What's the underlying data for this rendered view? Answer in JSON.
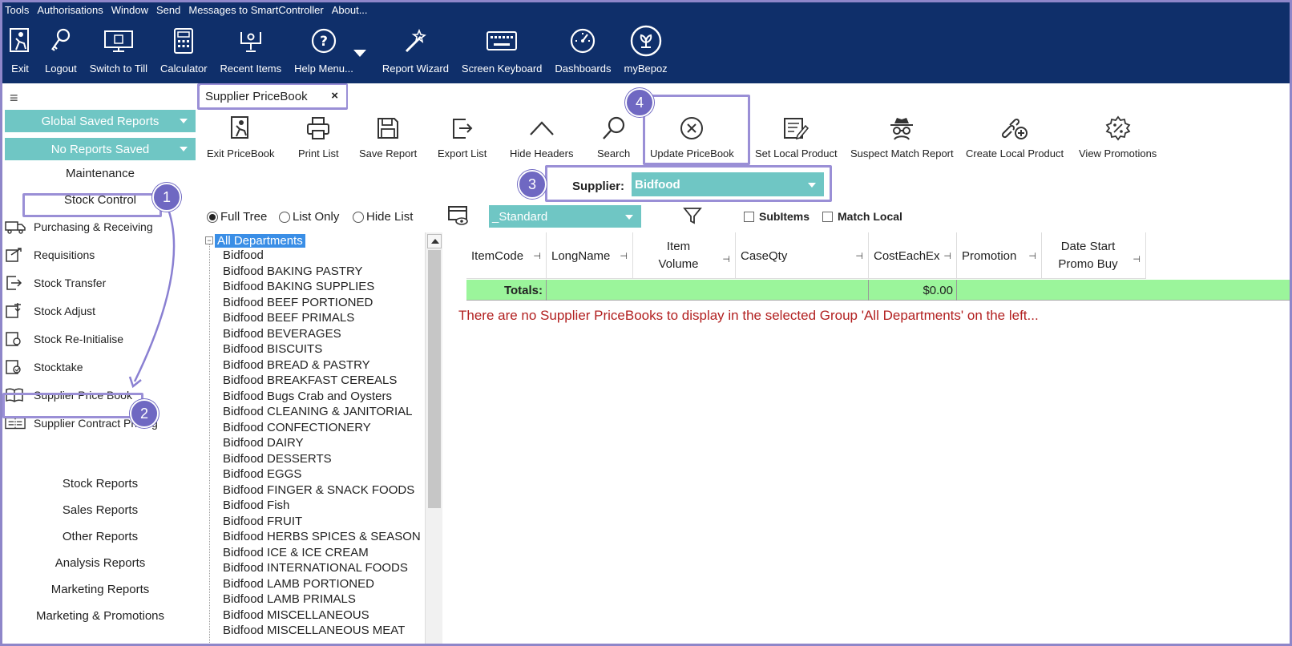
{
  "menubar": [
    "Tools",
    "Authorisations",
    "Window",
    "Send",
    "Messages to SmartController",
    "About..."
  ],
  "toolbar_main": [
    {
      "label": "Exit",
      "icon": "exit-icon"
    },
    {
      "label": "Logout",
      "icon": "key-icon"
    },
    {
      "label": "Switch to Till",
      "icon": "till-icon"
    },
    {
      "label": "Calculator",
      "icon": "calculator-icon"
    },
    {
      "label": "Recent Items",
      "icon": "recent-items-icon"
    },
    {
      "label": "Help Menu...",
      "icon": "help-icon"
    },
    {
      "label": "Report Wizard",
      "icon": "wand-icon"
    },
    {
      "label": "Screen Keyboard",
      "icon": "keyboard-icon"
    },
    {
      "label": "Dashboards",
      "icon": "gauge-icon"
    },
    {
      "label": "myBepoz",
      "icon": "bepoz-logo-icon"
    }
  ],
  "sidebar": {
    "global_reports": "Global Saved Reports",
    "no_reports": "No Reports Saved",
    "maintenance": "Maintenance",
    "stock_control": "Stock Control",
    "items": [
      {
        "label": "Purchasing & Receiving",
        "icon": "truck-icon"
      },
      {
        "label": "Requisitions",
        "icon": "requisition-icon"
      },
      {
        "label": "Stock Transfer",
        "icon": "transfer-icon"
      },
      {
        "label": "Stock Adjust",
        "icon": "adjust-icon"
      },
      {
        "label": "Stock Re-Initialise",
        "icon": "reinitialise-icon"
      },
      {
        "label": "Stocktake",
        "icon": "stocktake-icon"
      },
      {
        "label": "Supplier Price Book",
        "icon": "book-icon"
      },
      {
        "label": "Supplier Contract Pricing",
        "icon": "contract-icon"
      }
    ],
    "reports": [
      "Stock Reports",
      "Sales Reports",
      "Other Reports",
      "Analysis Reports",
      "Marketing Reports",
      "Marketing & Promotions"
    ]
  },
  "tab": {
    "label": "Supplier PriceBook",
    "close": "×"
  },
  "pricebook_toolbar": [
    {
      "label": "Exit PriceBook"
    },
    {
      "label": "Print List"
    },
    {
      "label": "Save Report"
    },
    {
      "label": "Export List"
    },
    {
      "label": "Hide Headers"
    },
    {
      "label": "Search"
    },
    {
      "label": "Update PriceBook"
    },
    {
      "label": "Set Local Product"
    },
    {
      "label": "Suspect Match Report"
    },
    {
      "label": "Create Local Product"
    },
    {
      "label": "View Promotions"
    }
  ],
  "supplier": {
    "label": "Supplier:",
    "value": "Bidfood"
  },
  "view_options": {
    "full_tree": "Full Tree",
    "list_only": "List Only",
    "hide_list": "Hide List",
    "selected": "full_tree"
  },
  "layout_dropdown": "_Standard",
  "checkboxes": {
    "subitems": "SubItems",
    "match_local": "Match Local"
  },
  "tree": {
    "root": "All Departments",
    "children": [
      "Bidfood",
      "Bidfood BAKING PASTRY",
      "Bidfood BAKING SUPPLIES",
      "Bidfood BEEF PORTIONED",
      "Bidfood BEEF PRIMALS",
      "Bidfood BEVERAGES",
      "Bidfood BISCUITS",
      "Bidfood BREAD & PASTRY",
      "Bidfood BREAKFAST CEREALS",
      "Bidfood Bugs  Crab and Oysters",
      "Bidfood CLEANING & JANITORIAL",
      "Bidfood CONFECTIONERY",
      "Bidfood DAIRY",
      "Bidfood DESSERTS",
      "Bidfood EGGS",
      "Bidfood FINGER & SNACK FOODS",
      "Bidfood Fish",
      "Bidfood FRUIT",
      "Bidfood HERBS  SPICES & SEASON",
      "Bidfood ICE & ICE CREAM",
      "Bidfood INTERNATIONAL FOODS",
      "Bidfood LAMB PORTIONED",
      "Bidfood LAMB PRIMALS",
      "Bidfood MISCELLANEOUS",
      "Bidfood MISCELLANEOUS MEAT"
    ]
  },
  "grid": {
    "columns": [
      {
        "label": "ItemCode"
      },
      {
        "label": "LongName"
      },
      {
        "label": "Item\nVolume"
      },
      {
        "label": "CaseQty"
      },
      {
        "label": "CostEachEx"
      },
      {
        "label": "Promotion"
      },
      {
        "label": "Date Start\nPromo Buy"
      }
    ],
    "totals_label": "Totals:",
    "totals_cost": "$0.00",
    "empty_message": "There are no Supplier PriceBooks to display in the selected Group 'All Departments' on the left..."
  },
  "badges": [
    "1",
    "2",
    "3",
    "4"
  ],
  "colors": {
    "topbar": "#0f2f6a",
    "teal": "#6fc6c4",
    "totals": "#9bf59b",
    "highlight": "#9a8fd6",
    "badge": "#6f68c2",
    "message": "#b22020",
    "tree_selected": "#3a8ee6"
  }
}
